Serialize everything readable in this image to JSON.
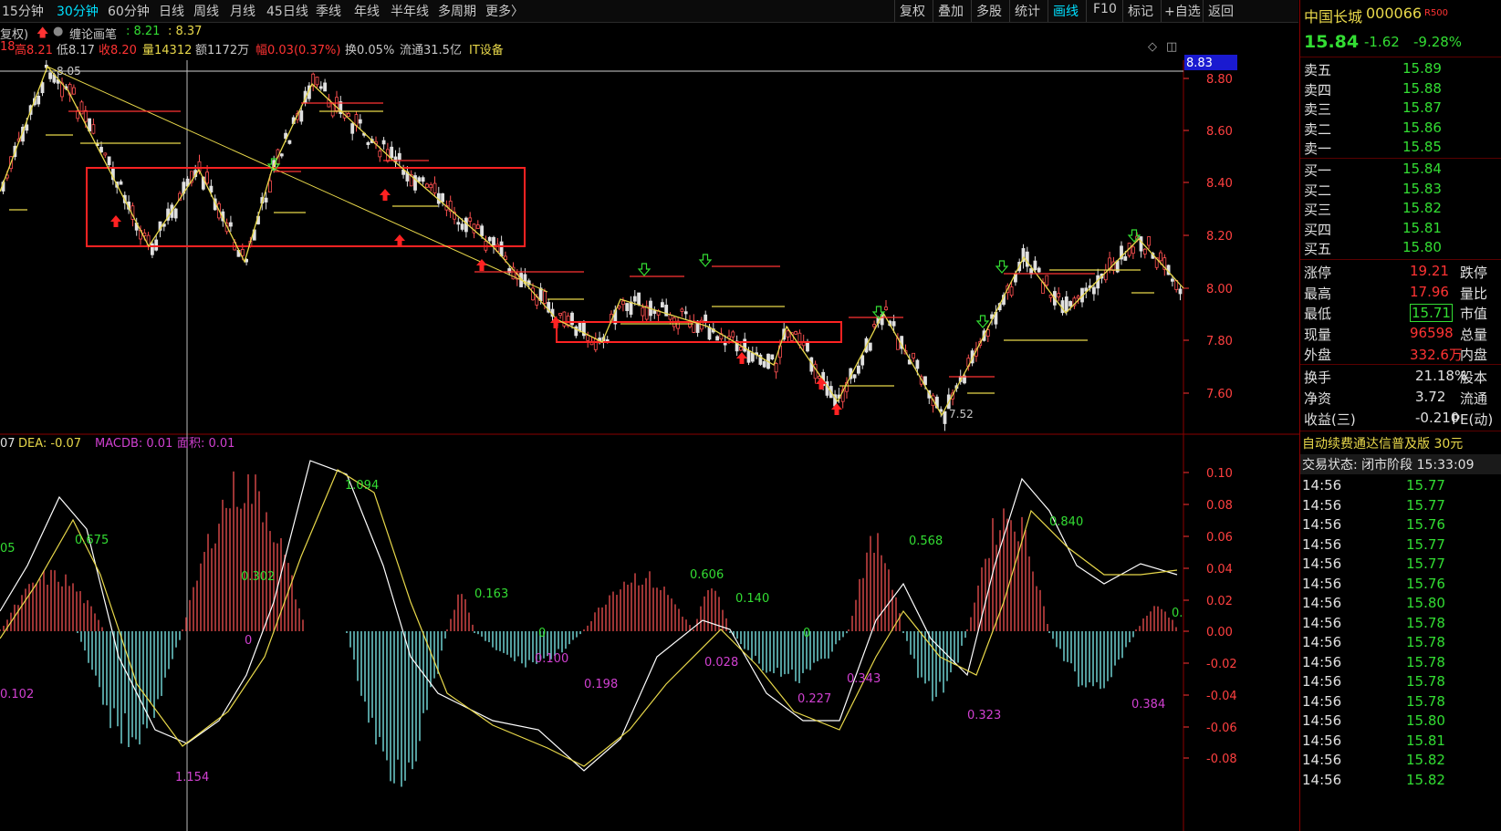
{
  "toolbar": {
    "periods": [
      "15分钟",
      "30分钟",
      "60分钟",
      "日线",
      "周线",
      "月线",
      "45日线",
      "季线",
      "年线",
      "半年线",
      "多周期",
      "更多〉"
    ],
    "active_period": "30分钟",
    "buttons": [
      "复权",
      "叠加",
      "多股",
      "统计",
      "画线",
      "F10",
      "标记",
      "+自选",
      "返回"
    ],
    "active_button": "画线"
  },
  "infobar": {
    "fuquan": "复权)",
    "indicator": "缠论画笔",
    "indicator_val1": ": 8.21",
    "indicator_val2": ": 8.37",
    "open_part": "18",
    "high": "高8.21",
    "low": "低8.17",
    "close": "收8.20",
    "volume": "量14312",
    "amount": "额1172万",
    "change": "幅0.03(0.37%)",
    "turnover": "换0.05%",
    "float": "流通31.5亿",
    "sector": "IT设备"
  },
  "price_axis": {
    "ticks": [
      "8.80",
      "8.60",
      "8.40",
      "8.20",
      "8.00",
      "7.80",
      "7.60"
    ],
    "current_marker": "8.83",
    "peak_label": "8.05",
    "low_label": "7.52"
  },
  "macd": {
    "legend_dif": "07",
    "legend_dea": "DEA: -0.07",
    "legend_macdb": "MACDB: 0.01",
    "legend_area": "面积: 0.01",
    "ticks": [
      "0.10",
      "0.08",
      "0.06",
      "0.04",
      "0.02",
      "0.00",
      "-0.02",
      "-0.04",
      "-0.06",
      "-0.08"
    ],
    "labels_green": [
      "05",
      "0.675",
      "0.302",
      "1.094",
      "0.163",
      "0",
      "0.606",
      "0.140",
      "0",
      "0.568",
      "0.840",
      "0."
    ],
    "labels_magenta": [
      "0.102",
      "0",
      "0.100",
      "0.198",
      "0.028",
      "0.227",
      "0.343",
      "0.323",
      "0.384",
      "1.154"
    ]
  },
  "quote": {
    "name": "中国长城",
    "code": "000066",
    "badge": "R500",
    "price": "15.84",
    "change": "-1.62",
    "pct": "-9.28%",
    "asks": [
      {
        "label": "卖五",
        "price": "15.89"
      },
      {
        "label": "卖四",
        "price": "15.88"
      },
      {
        "label": "卖三",
        "price": "15.87"
      },
      {
        "label": "卖二",
        "price": "15.86"
      },
      {
        "label": "卖一",
        "price": "15.85"
      }
    ],
    "bids": [
      {
        "label": "买一",
        "price": "15.84"
      },
      {
        "label": "买二",
        "price": "15.83"
      },
      {
        "label": "买三",
        "price": "15.82"
      },
      {
        "label": "买四",
        "price": "15.81"
      },
      {
        "label": "买五",
        "price": "15.80"
      }
    ],
    "stats": [
      {
        "label": "涨停",
        "value": "19.21",
        "label2": "跌停"
      },
      {
        "label": "最高",
        "value": "17.96",
        "label2": "量比"
      },
      {
        "label": "最低",
        "value": "15.71",
        "label2": "市值"
      },
      {
        "label": "现量",
        "value": "96598",
        "label2": "总量"
      },
      {
        "label": "外盘",
        "value": "332.6万",
        "label2": "内盘"
      }
    ],
    "stats2": [
      {
        "label": "换手",
        "value": "21.18%",
        "label2": "股本"
      },
      {
        "label": "净资",
        "value": "3.72",
        "label2": "流通"
      },
      {
        "label": "收益(三)",
        "value": "-0.210",
        "label2": "PE(动)"
      }
    ],
    "ad": "自动续费通达信普及版  30元",
    "status": "交易状态: 闭市阶段 15:33:09",
    "ticks": [
      {
        "time": "14:56",
        "price": "15.77"
      },
      {
        "time": "14:56",
        "price": "15.77"
      },
      {
        "time": "14:56",
        "price": "15.76"
      },
      {
        "time": "14:56",
        "price": "15.77"
      },
      {
        "time": "14:56",
        "price": "15.77"
      },
      {
        "time": "14:56",
        "price": "15.76"
      },
      {
        "time": "14:56",
        "price": "15.80"
      },
      {
        "time": "14:56",
        "price": "15.78"
      },
      {
        "time": "14:56",
        "price": "15.78"
      },
      {
        "time": "14:56",
        "price": "15.78"
      },
      {
        "time": "14:56",
        "price": "15.78"
      },
      {
        "time": "14:56",
        "price": "15.78"
      },
      {
        "time": "14:56",
        "price": "15.80"
      },
      {
        "time": "14:56",
        "price": "15.81"
      },
      {
        "time": "14:56",
        "price": "15.82"
      },
      {
        "time": "14:56",
        "price": "15.82"
      }
    ]
  },
  "colors": {
    "up": "#ff3333",
    "down": "#33dd33",
    "accent": "#00e0ff",
    "macd_up": "#d04545",
    "macd_down": "#6fd0d0"
  }
}
